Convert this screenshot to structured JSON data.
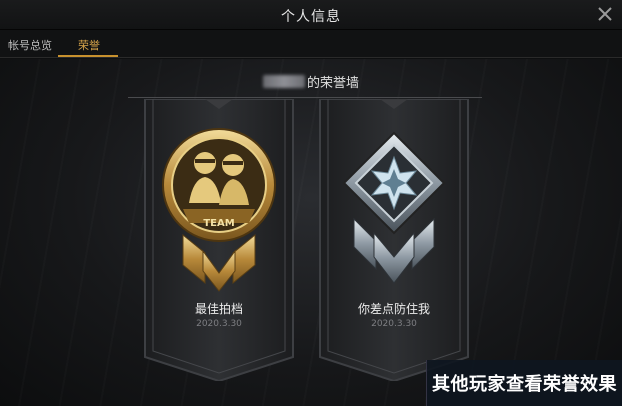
{
  "window": {
    "title": "个人信息",
    "close_icon": "close-icon"
  },
  "tabs": [
    {
      "label": "帐号总览",
      "active": false
    },
    {
      "label": "荣誉",
      "active": true
    }
  ],
  "honor_wall": {
    "title_suffix": "的荣誉墙"
  },
  "badges": [
    {
      "name": "最佳拍档",
      "date": "2020.3.30",
      "emblem_text": "TEAM",
      "icon": "team-badge-icon"
    },
    {
      "name": "你差点防住我",
      "date": "2020.3.30",
      "icon": "star-badge-icon"
    }
  ],
  "caption": "其他玩家查看荣誉效果",
  "colors": {
    "accent": "#c8912e",
    "gold": "#d6b56a",
    "silver": "#9aa4ad"
  }
}
